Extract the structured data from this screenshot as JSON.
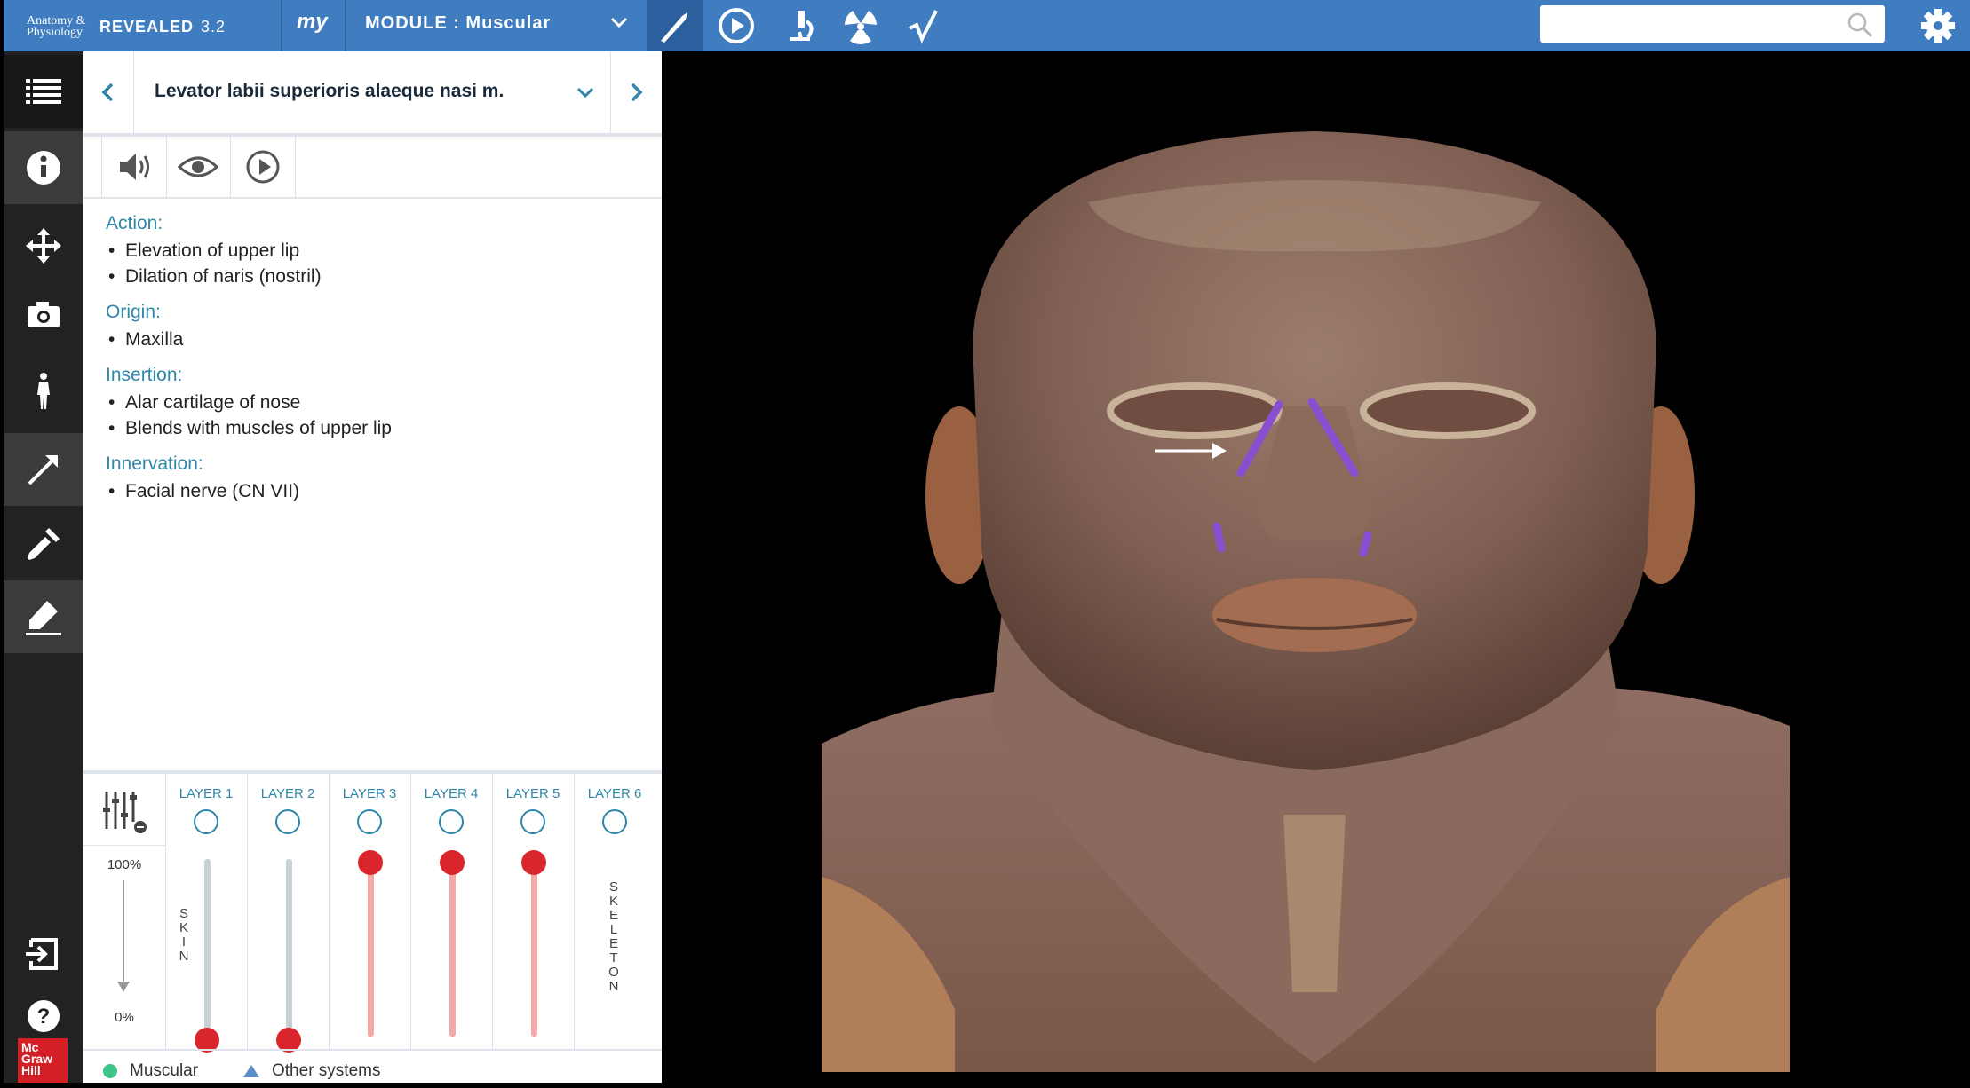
{
  "app": {
    "brand_small": "Anatomy & Physiology",
    "brand_name": "REVEALED",
    "version": "3.2",
    "my_label": "my",
    "module_label": "MODULE : Muscular"
  },
  "search": {
    "placeholder": ""
  },
  "structure": {
    "title": "Levator labii superioris alaeque nasi m."
  },
  "info": {
    "sections": [
      {
        "label": "Action:",
        "items": [
          "Elevation of upper lip",
          "Dilation of naris (nostril)"
        ]
      },
      {
        "label": "Origin:",
        "items": [
          "Maxilla"
        ]
      },
      {
        "label": "Insertion:",
        "items": [
          "Alar cartilage of nose",
          "Blends with muscles of upper lip"
        ]
      },
      {
        "label": "Innervation:",
        "items": [
          "Facial nerve (CN VII)"
        ]
      }
    ]
  },
  "layers": {
    "pct_top": "100%",
    "pct_bottom": "0%",
    "columns": [
      {
        "label": "LAYER 1",
        "vertical": "SKIN",
        "value_pct": 0
      },
      {
        "label": "LAYER 2",
        "vertical": "",
        "value_pct": 0
      },
      {
        "label": "LAYER 3",
        "vertical": "",
        "value_pct": 100
      },
      {
        "label": "LAYER 4",
        "vertical": "",
        "value_pct": 100
      },
      {
        "label": "LAYER 5",
        "vertical": "",
        "value_pct": 100
      },
      {
        "label": "LAYER 6",
        "vertical": "SKELETON",
        "value_pct": null
      }
    ]
  },
  "legend": {
    "muscular": "Muscular",
    "other": "Other systems"
  },
  "colors": {
    "topbar": "#3f7cc0",
    "accent_teal": "#2f87aa",
    "slider_red": "#d8262c",
    "highlight_purple": "#8a4fd0"
  }
}
